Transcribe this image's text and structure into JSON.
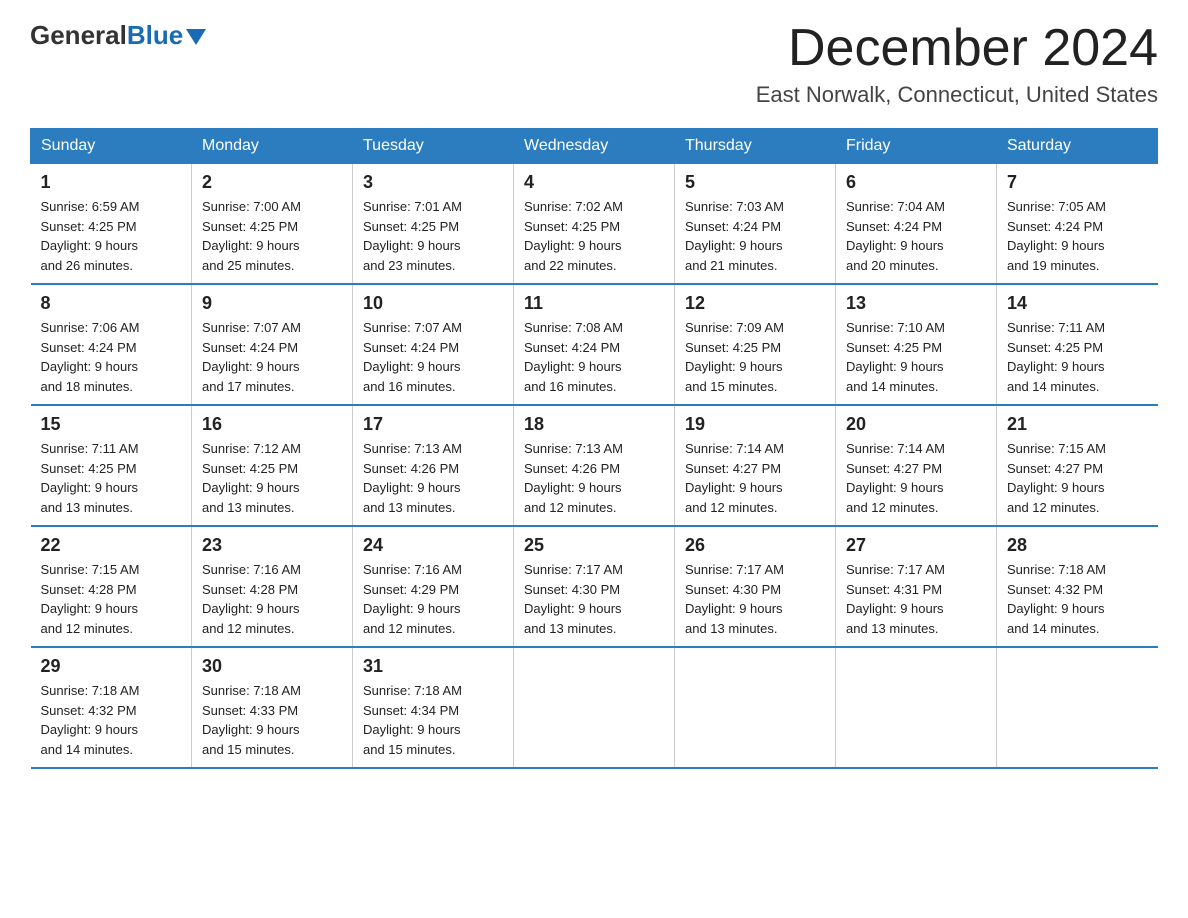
{
  "header": {
    "logo_general": "General",
    "logo_blue": "Blue",
    "month": "December 2024",
    "location": "East Norwalk, Connecticut, United States"
  },
  "days_of_week": [
    "Sunday",
    "Monday",
    "Tuesday",
    "Wednesday",
    "Thursday",
    "Friday",
    "Saturday"
  ],
  "weeks": [
    [
      {
        "day": "1",
        "sunrise": "6:59 AM",
        "sunset": "4:25 PM",
        "daylight": "9 hours and 26 minutes."
      },
      {
        "day": "2",
        "sunrise": "7:00 AM",
        "sunset": "4:25 PM",
        "daylight": "9 hours and 25 minutes."
      },
      {
        "day": "3",
        "sunrise": "7:01 AM",
        "sunset": "4:25 PM",
        "daylight": "9 hours and 23 minutes."
      },
      {
        "day": "4",
        "sunrise": "7:02 AM",
        "sunset": "4:25 PM",
        "daylight": "9 hours and 22 minutes."
      },
      {
        "day": "5",
        "sunrise": "7:03 AM",
        "sunset": "4:24 PM",
        "daylight": "9 hours and 21 minutes."
      },
      {
        "day": "6",
        "sunrise": "7:04 AM",
        "sunset": "4:24 PM",
        "daylight": "9 hours and 20 minutes."
      },
      {
        "day": "7",
        "sunrise": "7:05 AM",
        "sunset": "4:24 PM",
        "daylight": "9 hours and 19 minutes."
      }
    ],
    [
      {
        "day": "8",
        "sunrise": "7:06 AM",
        "sunset": "4:24 PM",
        "daylight": "9 hours and 18 minutes."
      },
      {
        "day": "9",
        "sunrise": "7:07 AM",
        "sunset": "4:24 PM",
        "daylight": "9 hours and 17 minutes."
      },
      {
        "day": "10",
        "sunrise": "7:07 AM",
        "sunset": "4:24 PM",
        "daylight": "9 hours and 16 minutes."
      },
      {
        "day": "11",
        "sunrise": "7:08 AM",
        "sunset": "4:24 PM",
        "daylight": "9 hours and 16 minutes."
      },
      {
        "day": "12",
        "sunrise": "7:09 AM",
        "sunset": "4:25 PM",
        "daylight": "9 hours and 15 minutes."
      },
      {
        "day": "13",
        "sunrise": "7:10 AM",
        "sunset": "4:25 PM",
        "daylight": "9 hours and 14 minutes."
      },
      {
        "day": "14",
        "sunrise": "7:11 AM",
        "sunset": "4:25 PM",
        "daylight": "9 hours and 14 minutes."
      }
    ],
    [
      {
        "day": "15",
        "sunrise": "7:11 AM",
        "sunset": "4:25 PM",
        "daylight": "9 hours and 13 minutes."
      },
      {
        "day": "16",
        "sunrise": "7:12 AM",
        "sunset": "4:25 PM",
        "daylight": "9 hours and 13 minutes."
      },
      {
        "day": "17",
        "sunrise": "7:13 AM",
        "sunset": "4:26 PM",
        "daylight": "9 hours and 13 minutes."
      },
      {
        "day": "18",
        "sunrise": "7:13 AM",
        "sunset": "4:26 PM",
        "daylight": "9 hours and 12 minutes."
      },
      {
        "day": "19",
        "sunrise": "7:14 AM",
        "sunset": "4:27 PM",
        "daylight": "9 hours and 12 minutes."
      },
      {
        "day": "20",
        "sunrise": "7:14 AM",
        "sunset": "4:27 PM",
        "daylight": "9 hours and 12 minutes."
      },
      {
        "day": "21",
        "sunrise": "7:15 AM",
        "sunset": "4:27 PM",
        "daylight": "9 hours and 12 minutes."
      }
    ],
    [
      {
        "day": "22",
        "sunrise": "7:15 AM",
        "sunset": "4:28 PM",
        "daylight": "9 hours and 12 minutes."
      },
      {
        "day": "23",
        "sunrise": "7:16 AM",
        "sunset": "4:28 PM",
        "daylight": "9 hours and 12 minutes."
      },
      {
        "day": "24",
        "sunrise": "7:16 AM",
        "sunset": "4:29 PM",
        "daylight": "9 hours and 12 minutes."
      },
      {
        "day": "25",
        "sunrise": "7:17 AM",
        "sunset": "4:30 PM",
        "daylight": "9 hours and 13 minutes."
      },
      {
        "day": "26",
        "sunrise": "7:17 AM",
        "sunset": "4:30 PM",
        "daylight": "9 hours and 13 minutes."
      },
      {
        "day": "27",
        "sunrise": "7:17 AM",
        "sunset": "4:31 PM",
        "daylight": "9 hours and 13 minutes."
      },
      {
        "day": "28",
        "sunrise": "7:18 AM",
        "sunset": "4:32 PM",
        "daylight": "9 hours and 14 minutes."
      }
    ],
    [
      {
        "day": "29",
        "sunrise": "7:18 AM",
        "sunset": "4:32 PM",
        "daylight": "9 hours and 14 minutes."
      },
      {
        "day": "30",
        "sunrise": "7:18 AM",
        "sunset": "4:33 PM",
        "daylight": "9 hours and 15 minutes."
      },
      {
        "day": "31",
        "sunrise": "7:18 AM",
        "sunset": "4:34 PM",
        "daylight": "9 hours and 15 minutes."
      },
      null,
      null,
      null,
      null
    ]
  ]
}
